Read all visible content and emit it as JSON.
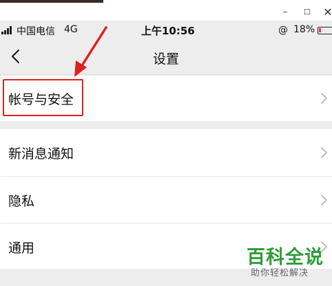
{
  "window": {
    "minimize_glyph": "–",
    "maximize_glyph": "☐",
    "close_glyph": "✕"
  },
  "status_bar": {
    "carrier": "中国电信",
    "network": "4G",
    "time": "上午10:56",
    "lock_icon": "rotation-lock-icon",
    "lock_glyph": "@",
    "battery_percent": "18%",
    "battery_level": 0.18,
    "battery_color": "#e53935"
  },
  "nav": {
    "back_icon": "chevron-left-icon",
    "title": "设置"
  },
  "settings": {
    "items": [
      {
        "label": "帐号与安全"
      },
      {
        "label": "新消息通知"
      },
      {
        "label": "隐私"
      },
      {
        "label": "通用"
      }
    ],
    "chevron_icon": "chevron-right-icon"
  },
  "annotation": {
    "color": "#e02020"
  },
  "watermark": {
    "main": "百科全说",
    "sub": "助你轻松解决",
    "color": "#2e9b3a"
  }
}
